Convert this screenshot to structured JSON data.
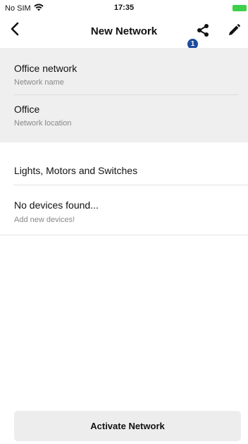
{
  "status_bar": {
    "carrier": "No SIM",
    "time": "17:35",
    "wifi_icon": "wifi-icon",
    "battery_icon": "battery-icon",
    "battery_color": "#3ecf4b"
  },
  "nav": {
    "title": "New Network",
    "back_icon": "chevron-left-icon",
    "share_icon": "share-icon",
    "edit_icon": "pencil-icon",
    "share_badge": "1",
    "badge_color": "#1c4c9c"
  },
  "network": {
    "name_value": "Office network",
    "name_label": "Network name",
    "location_value": "Office",
    "location_label": "Network location"
  },
  "devices": {
    "section_title": "Lights, Motors and Switches",
    "empty_title": "No devices found...",
    "empty_subtitle": "Add new devices!"
  },
  "actions": {
    "activate_label": "Activate Network"
  }
}
